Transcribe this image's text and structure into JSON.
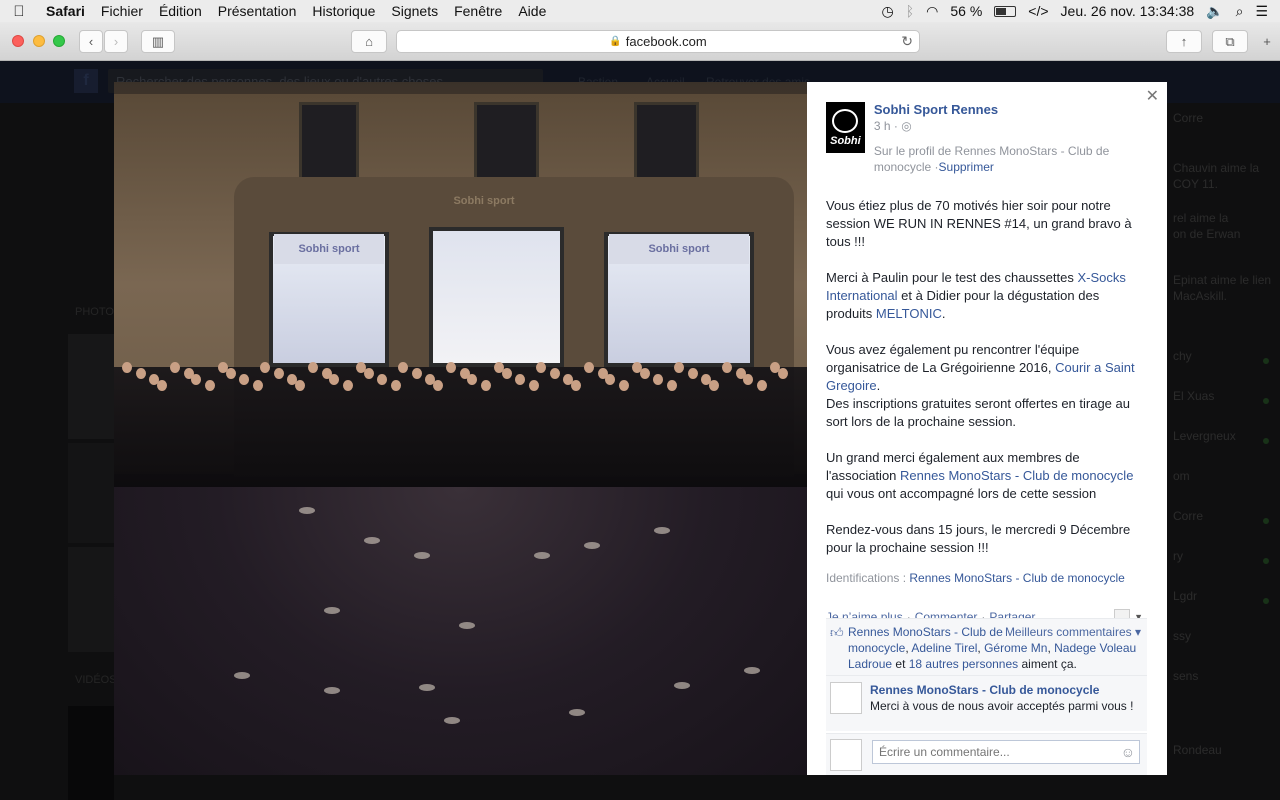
{
  "menubar": {
    "apple": "",
    "items": [
      "Safari",
      "Fichier",
      "Édition",
      "Présentation",
      "Historique",
      "Signets",
      "Fenêtre",
      "Aide"
    ],
    "battery": "56 %",
    "datetime": "Jeu. 26 nov.  13:34:38",
    "battery_level_pct": 56
  },
  "browser": {
    "url": "facebook.com"
  },
  "background_page": {
    "search_placeholder": "Rechercher des personnes, des lieux ou d'autres choses",
    "nav": [
      "Bastien",
      "Accueil",
      "Retrouver des amis"
    ],
    "left_labels": [
      "PHOTOS",
      "VIDÉOS"
    ],
    "chat_names": [
      "Corre",
      "Chauvin aime la",
      "COY 11.",
      "rel aime la",
      "on de Erwan",
      "Epinat aime le lien",
      "MacAskill.",
      "chy",
      "El Xuas",
      "Levergneux",
      "om",
      "Corre",
      "ry",
      "Lgdr",
      "ssy",
      "sens",
      "Rondeau"
    ]
  },
  "post": {
    "page_name": "Sobhi Sport Rennes",
    "logo_text": "Sobhi",
    "time": "3 h ·",
    "via": "Sur le profil de Rennes MonoStars - Club de monocycle ·",
    "delete": "Supprimer",
    "paragraphs": [
      "Vous étiez plus de 70 motivés hier soir pour notre session WE RUN IN RENNES #14, un grand bravo à tous !!!"
    ],
    "p2_a": "Merci à Paulin pour le test des chaussettes ",
    "p2_link1": "X-Socks International",
    "p2_b": " et à Didier pour la dégustation des produits ",
    "p2_link2": "MELTONIC",
    "p2_c": ".",
    "p3_a": "Vous avez également pu rencontrer l'équipe organisatrice de La Grégoirienne 2016, ",
    "p3_link": "Courir a Saint Gregoire",
    "p3_b": ".",
    "p3_c": "Des inscriptions gratuites seront offertes en tirage au sort lors de la prochaine session.",
    "p4_a": "Un grand merci également aux membres de l'association ",
    "p4_link": "Rennes MonoStars - Club de monocycle",
    "p4_b": " qui vous ont accompagné lors de cette session",
    "p5": "Rendez-vous dans 15 jours, le mercredi 9 Décembre pour la prochaine session !!!",
    "tags_label": "Identifications :",
    "tags_value": "Rennes MonoStars - Club de monocycle",
    "actions": {
      "like": "Je n’aime plus",
      "comment": "Commenter",
      "share": "Partager"
    },
    "likes": {
      "names": "Rennes MonoStars - Club de monocycle",
      "n2": "Adeline Tirel",
      "n3": "Gérome Mn",
      "n4": "Nadege Voleau Ladroue",
      "and": "et",
      "others": "18 autres personnes",
      "suffix": "aiment ça.",
      "best": "Meilleurs commentaires ▾"
    },
    "comment": {
      "author": "Rennes MonoStars - Club de monocycle",
      "text": "Merci à vous de nous avoir acceptés parmi vous !"
    },
    "new_comment_placeholder": "Écrire un commentaire..."
  },
  "photo": {
    "signs": [
      "Sobhi sport",
      "Sobhi sport",
      "Sobhi sport"
    ]
  }
}
